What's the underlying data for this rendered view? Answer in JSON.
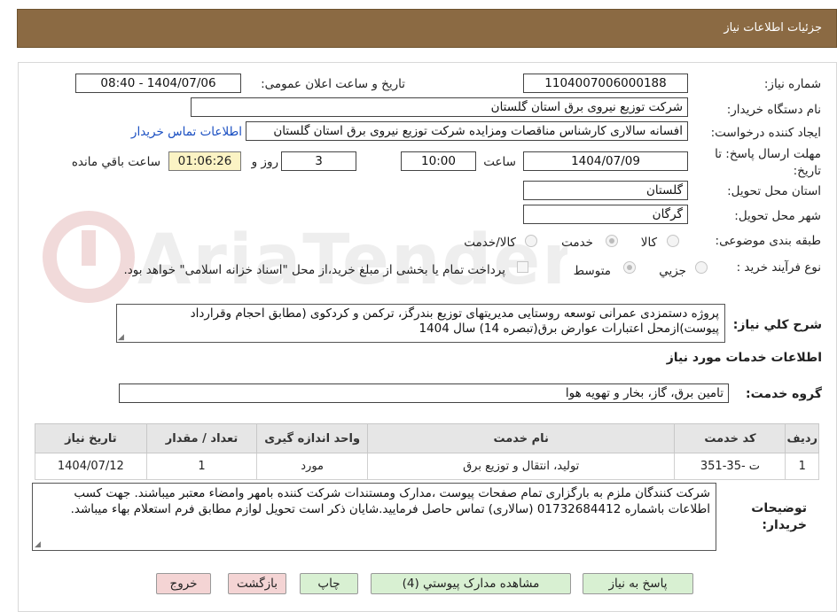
{
  "header": {
    "title": "جزئیات اطلاعات نیاز"
  },
  "form": {
    "need_number_label": "شماره نیاز:",
    "need_number": "1104007006000188",
    "announce_label": "تاریخ و ساعت اعلان عمومی:",
    "announce_value": "1404/07/06 - 08:40",
    "buyer_org_label": "نام دستگاه خریدار:",
    "buyer_org": "شرکت توزیع نیروی برق استان گلستان",
    "creator_label": "ایجاد کننده درخواست:",
    "creator": "افسانه سالاری کارشناس مناقصات ومزایده شرکت توزیع نیروی برق استان گلستان",
    "contact_link": "اطلاعات تماس خریدار",
    "deadline_label_1": "مهلت ارسال پاسخ: تا",
    "deadline_label_2": "تاریخ:",
    "deadline_date": "1404/07/09",
    "time_label": "ساعت",
    "deadline_time": "10:00",
    "days_value": "3",
    "days_label": "روز و",
    "remaining_time": "01:06:26",
    "remaining_label": "ساعت باقي مانده",
    "province_label": "استان محل تحویل:",
    "province": "گلستان",
    "city_label": "شهر محل تحویل:",
    "city": "گرگان",
    "category_label": "طبقه بندی موضوعی:",
    "category_options": [
      "کالا",
      "خدمت",
      "کالا/خدمت"
    ],
    "process_label": "نوع فرآیند خرید :",
    "process_options": [
      "جزيي",
      "متوسط"
    ],
    "payment_note": "پرداخت تمام یا بخشی از مبلغ خرید،از محل \"اسناد خزانه اسلامی\" خواهد بود."
  },
  "description": {
    "label": "شرح کلي نياز:",
    "text": "پروژه دستمزدی عمرانی توسعه روستایی مدیریتهای توزیع بندرگز، ترکمن و کردکوی  (مطابق احجام وقرارداد پیوست)ازمحل اعتبارات عوارض برق(تبصره 14) سال 1404"
  },
  "services": {
    "section_title": "اطلاعات خدمات مورد نياز",
    "group_label": "گروه خدمت:",
    "group_value": "تامین برق، گاز، بخار و تهویه هوا",
    "columns": [
      "ردیف",
      "کد خدمت",
      "نام خدمت",
      "واحد اندازه گیری",
      "تعداد / مقدار",
      "تاریخ نیاز"
    ],
    "rows": [
      [
        "1",
        "ت -35-351",
        "تولید، انتقال و توزیع برق",
        "مورد",
        "1",
        "1404/07/12"
      ]
    ]
  },
  "buyer_notes": {
    "label_1": "توضیحات",
    "label_2": "خریدار:",
    "text": "شرکت کنندگان ملزم به بارگزاری تمام صفحات پیوست ،مدارک ومستندات شرکت کننده بامهر وامضاء معتبر میباشند. جهت کسب اطلاعات باشماره 01732684412 (سالاری) تماس حاصل فرمایید.شایان ذکر است تحویل لوازم مطابق فرم استعلام بهاء میباشد."
  },
  "buttons": {
    "reply": "پاسخ به نیاز",
    "attachments": "مشاهده مدارک پیوستي (4)",
    "print": "چاپ",
    "back": "بازگشت",
    "exit": "خروج"
  },
  "watermark": {
    "text": "AriaTender.neT"
  },
  "colors": {
    "header_bg": "#8b6a43",
    "timer_bg": "#fbf3c4",
    "link": "#1a4fc2",
    "button_green": "#d8f0d2",
    "button_red": "#f4d4d4"
  }
}
